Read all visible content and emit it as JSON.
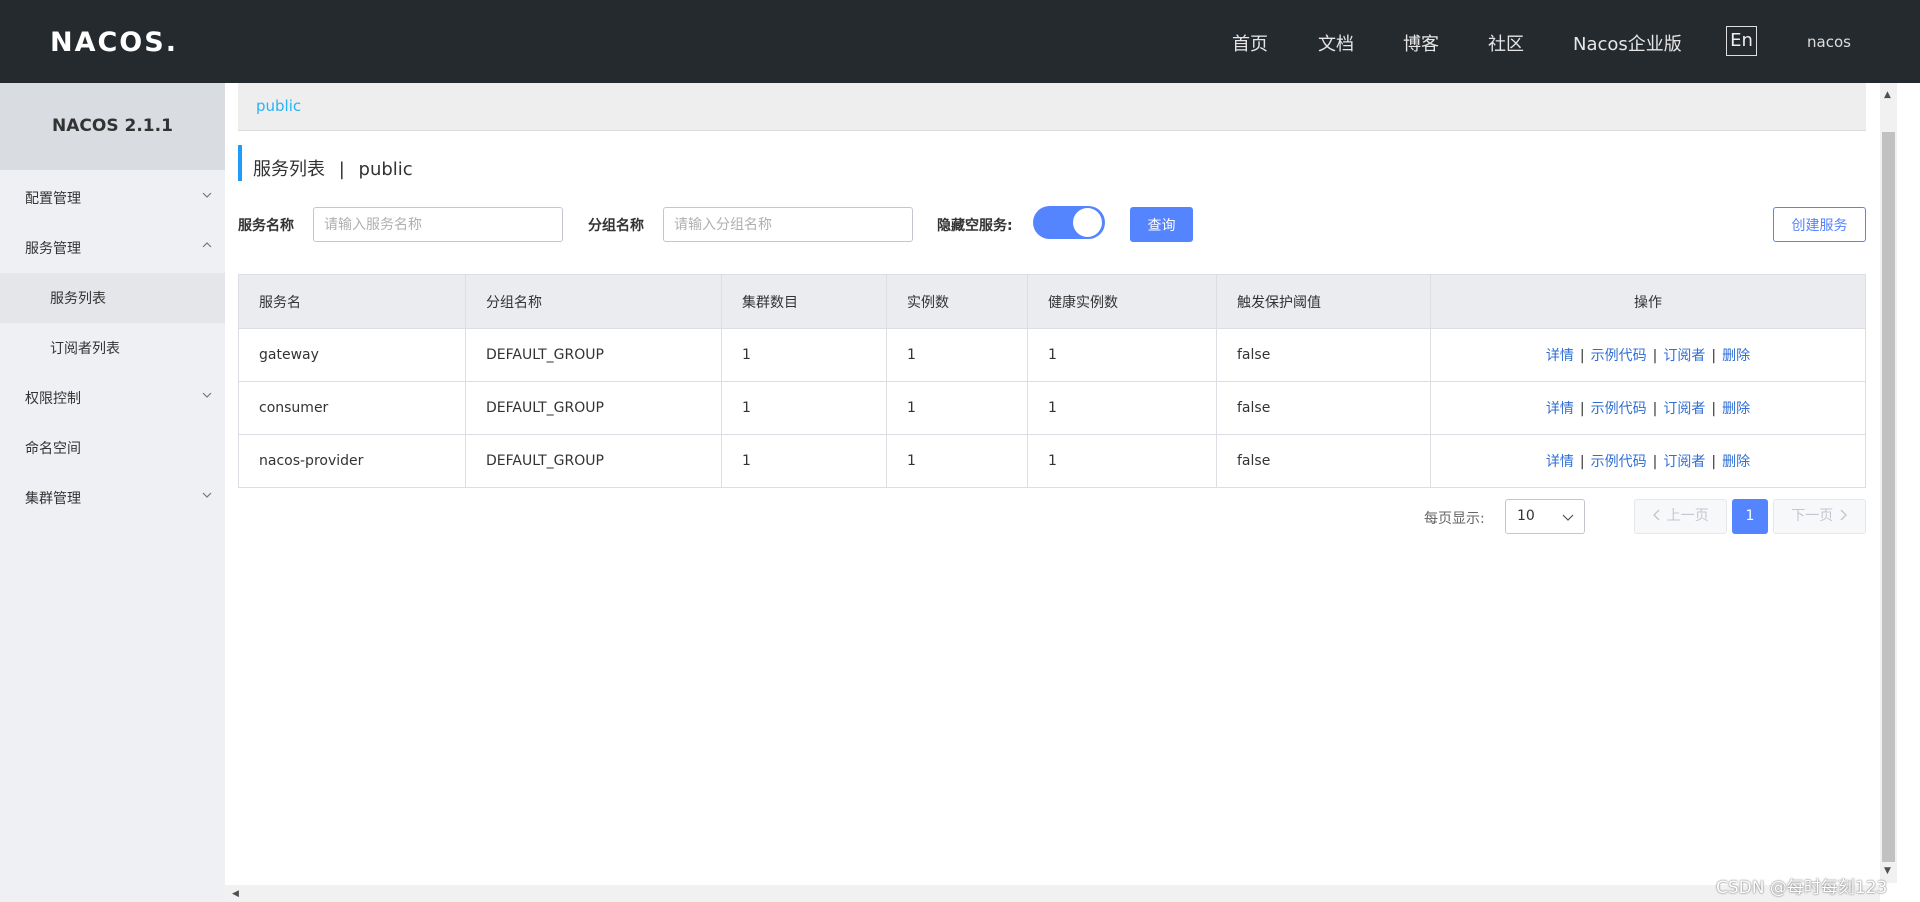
{
  "header": {
    "logo": "NACOS.",
    "nav": [
      "首页",
      "文档",
      "博客",
      "社区",
      "Nacos企业版"
    ],
    "lang": "En",
    "user": "nacos"
  },
  "sidebar": {
    "title": "NACOS 2.1.1",
    "items": [
      {
        "label": "配置管理"
      },
      {
        "label": "服务管理"
      },
      {
        "label": "服务列表"
      },
      {
        "label": "订阅者列表"
      },
      {
        "label": "权限控制"
      },
      {
        "label": "命名空间"
      },
      {
        "label": "集群管理"
      }
    ]
  },
  "breadcrumb": "public",
  "page": {
    "title": "服务列表",
    "separator": "|",
    "namespace": "public"
  },
  "filters": {
    "service_label": "服务名称",
    "service_placeholder": "请输入服务名称",
    "group_label": "分组名称",
    "group_placeholder": "请输入分组名称",
    "hide_empty_label": "隐藏空服务:",
    "hide_empty": true,
    "query_label": "查询",
    "create_label": "创建服务"
  },
  "table": {
    "headers": [
      "服务名",
      "分组名称",
      "集群数目",
      "实例数",
      "健康实例数",
      "触发保护阈值",
      "操作"
    ],
    "rows": [
      {
        "name": "gateway",
        "group": "DEFAULT_GROUP",
        "clusters": "1",
        "instances": "1",
        "healthy": "1",
        "threshold": "false"
      },
      {
        "name": "consumer",
        "group": "DEFAULT_GROUP",
        "clusters": "1",
        "instances": "1",
        "healthy": "1",
        "threshold": "false"
      },
      {
        "name": "nacos-provider",
        "group": "DEFAULT_GROUP",
        "clusters": "1",
        "instances": "1",
        "healthy": "1",
        "threshold": "false"
      }
    ],
    "actions": {
      "detail": "详情",
      "sample": "示例代码",
      "subscribers": "订阅者",
      "delete": "删除",
      "sep": "|"
    }
  },
  "pagination": {
    "page_size_label": "每页显示:",
    "page_size": "10",
    "prev": "上一页",
    "next": "下一页",
    "current": "1"
  },
  "watermark": "CSDN @每时每刻123",
  "colors": {
    "accent": "#5584ff",
    "header_bg": "#252a2f",
    "link": "#2f6fd6",
    "crumb": "#2bb2f2"
  }
}
